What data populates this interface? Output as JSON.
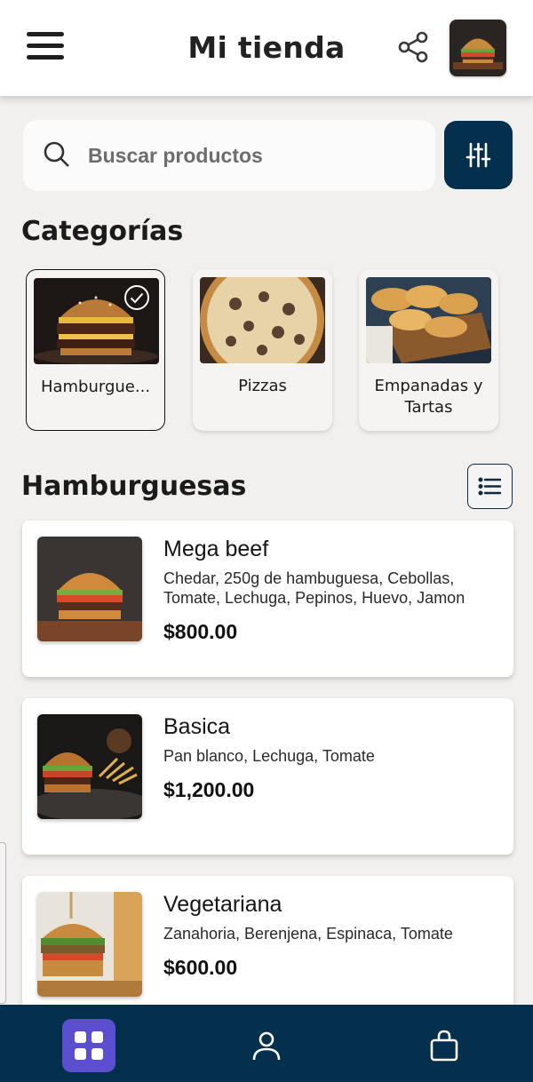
{
  "header": {
    "title": "Mi tienda",
    "menu_icon": "hamburger-menu-icon",
    "share_icon": "share-icon",
    "avatar": "store-logo-burger-image"
  },
  "search": {
    "placeholder": "Buscar productos",
    "icon": "search-icon",
    "filter_icon": "sliders-filter-icon"
  },
  "categories": {
    "title": "Categorías",
    "items": [
      {
        "label": "Hamburgue...",
        "image": "burger-photo",
        "selected": true
      },
      {
        "label": "Pizzas",
        "image": "pizza-photo",
        "selected": false
      },
      {
        "label": "Empanadas y Tartas",
        "image": "empanadas-photo",
        "selected": false
      }
    ]
  },
  "products": {
    "title": "Hamburguesas",
    "view_icon": "list-view-icon",
    "items": [
      {
        "name": "Mega beef",
        "description": "Chedar, 250g de hambuguesa, Cebollas, Tomate, Lechuga, Pepinos, Huevo, Jamon",
        "price": "$800.00",
        "image": "mega-beef-photo"
      },
      {
        "name": "Basica",
        "description": "Pan blanco, Lechuga, Tomate",
        "price": "$1,200.00",
        "image": "basica-photo"
      },
      {
        "name": "Vegetariana",
        "description": "Zanahoria, Berenjena, Espinaca, Tomate",
        "price": "$600.00",
        "image": "vegetariana-photo"
      }
    ]
  },
  "bottom_nav": {
    "items": [
      "grid-home-icon",
      "user-icon",
      "shopping-bag-icon"
    ]
  },
  "colors": {
    "navy": "#05304d",
    "active_nav": "#5b4fcf",
    "background": "#f1f0ef"
  }
}
